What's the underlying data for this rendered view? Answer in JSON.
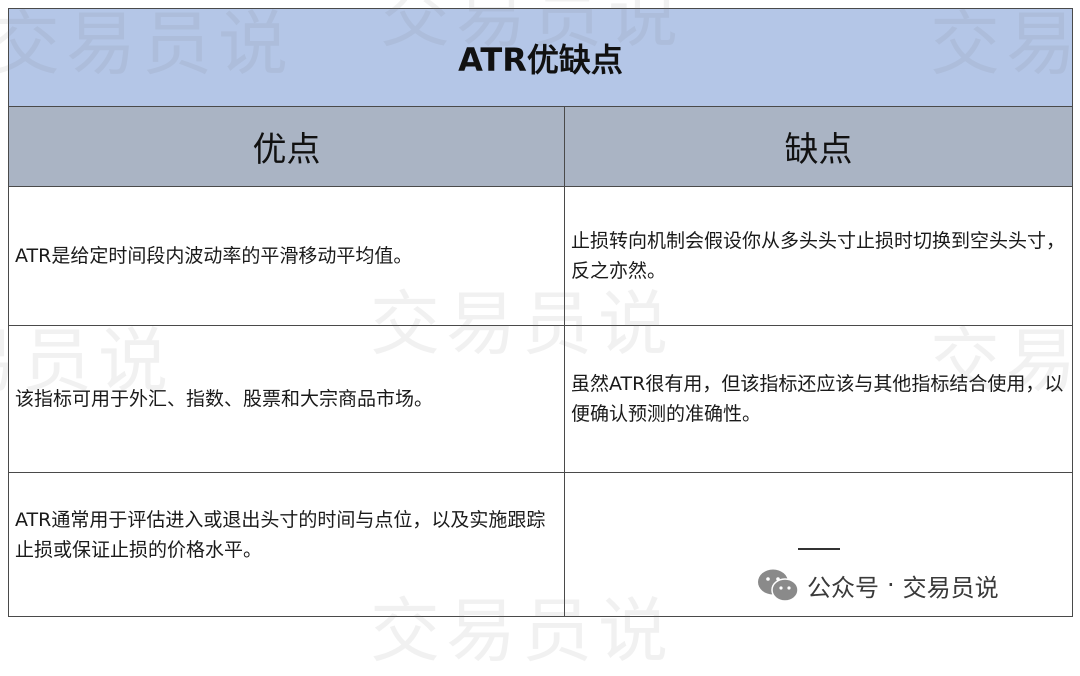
{
  "table": {
    "title": "ATR优缺点",
    "headers": {
      "pros": "优点",
      "cons": "缺点"
    },
    "rows": [
      {
        "pros": "ATR是给定时间段内波动率的平滑移动平均值。",
        "cons": "止损转向机制会假设你从多头头寸止损时切换到空头头寸，反之亦然。"
      },
      {
        "pros": "该指标可用于外汇、指数、股票和大宗商品市场。",
        "cons": "虽然ATR很有用，但该指标还应该与其他指标结合使用，以便确认预测的准确性。"
      },
      {
        "pros": "ATR通常用于评估进入或退出头寸的时间与点位，以及实施跟踪止损或保证止损的价格水平。",
        "cons": ""
      }
    ]
  },
  "watermark": {
    "text": "交易员说"
  },
  "footer": {
    "icon": "wechat-icon",
    "account_type": "公众号",
    "separator": "·",
    "account_name": "交易员说"
  },
  "colors": {
    "title_bg": "#b4c6e7",
    "header_bg": "#aab4c4",
    "border": "#4a4a4a"
  }
}
